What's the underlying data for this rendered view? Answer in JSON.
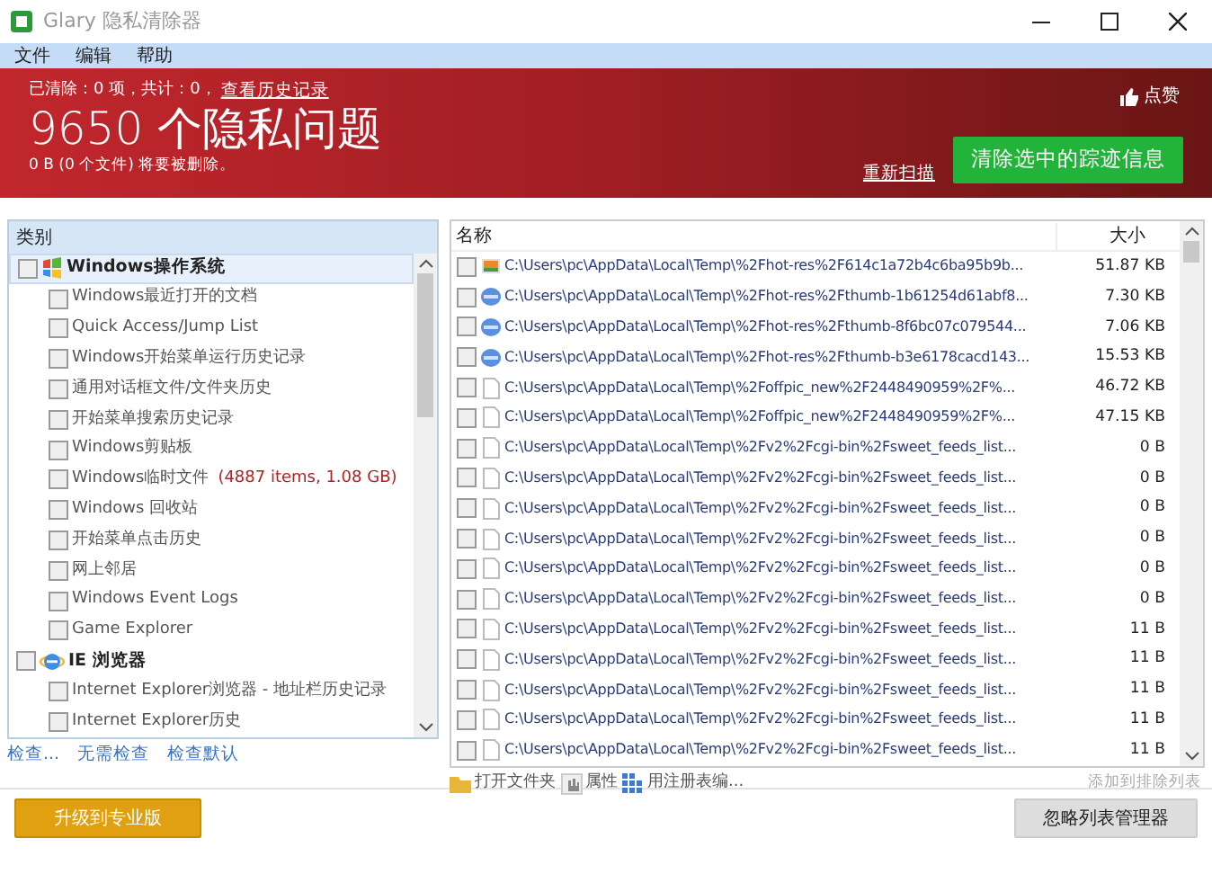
{
  "window": {
    "title": "Glary 隐私清除器"
  },
  "menu": [
    "文件",
    "编辑",
    "帮助"
  ],
  "header": {
    "summary": "已清除：0 项，共计：0，",
    "history_link": "查看历史记录",
    "like": "点赞",
    "headline": "9650 个隐私问题",
    "subline": "0 B (0 个文件) 将要被删除。",
    "rescan_link": "重新扫描",
    "clean_button": "清除选中的踪迹信息"
  },
  "categories": {
    "title": "类别",
    "groups": [
      {
        "label": "Windows操作系统",
        "kind": "windows",
        "checked": false,
        "children": [
          {
            "label": "Windows最近打开的文档",
            "checked": false
          },
          {
            "label": "Quick Access/Jump List",
            "checked": false
          },
          {
            "label": "Windows开始菜单运行历史记录",
            "checked": false
          },
          {
            "label": "通用对话框文件/文件夹历史",
            "checked": false
          },
          {
            "label": "开始菜单搜索历史记录",
            "checked": false
          },
          {
            "label": "Windows剪贴板",
            "checked": false
          },
          {
            "label": "Windows临时文件",
            "detail": "(4887 items, 1.08 GB)",
            "checked": false
          },
          {
            "label": "Windows 回收站",
            "checked": false
          },
          {
            "label": "开始菜单点击历史",
            "checked": false
          },
          {
            "label": "网上邻居",
            "checked": false
          },
          {
            "label": "Windows Event Logs",
            "checked": false
          },
          {
            "label": "Game Explorer",
            "checked": false
          }
        ]
      },
      {
        "label": "IE 浏览器",
        "kind": "ie",
        "checked": false,
        "children": [
          {
            "label": "Internet Explorer浏览器 - 地址栏历史记录",
            "checked": false
          },
          {
            "label": "Internet Explorer历史",
            "checked": false
          }
        ]
      }
    ]
  },
  "check_links": [
    "检查...",
    "无需检查",
    "检查默认"
  ],
  "files": {
    "columns": [
      "名称",
      "大小"
    ],
    "rows": [
      {
        "kind": "image",
        "name": "C:\\Users\\pc\\AppData\\Local\\Temp\\%2Fhot-res%2F614c1a72b4c6ba95b9b...",
        "size": "51.87 KB",
        "checked": false
      },
      {
        "kind": "jpg",
        "name": "C:\\Users\\pc\\AppData\\Local\\Temp\\%2Fhot-res%2Fthumb-1b61254d61abf8...",
        "size": "7.30 KB",
        "checked": false
      },
      {
        "kind": "jpg",
        "name": "C:\\Users\\pc\\AppData\\Local\\Temp\\%2Fhot-res%2Fthumb-8f6bc07c079544...",
        "size": "7.06 KB",
        "checked": false
      },
      {
        "kind": "jpg",
        "name": "C:\\Users\\pc\\AppData\\Local\\Temp\\%2Fhot-res%2Fthumb-b3e6178cacd143...",
        "size": "15.53 KB",
        "checked": false
      },
      {
        "kind": "file",
        "name": "C:\\Users\\pc\\AppData\\Local\\Temp\\%2Foffpic_new%2F2448490959%2F%...",
        "size": "46.72 KB",
        "checked": false
      },
      {
        "kind": "file",
        "name": "C:\\Users\\pc\\AppData\\Local\\Temp\\%2Foffpic_new%2F2448490959%2F%...",
        "size": "47.15 KB",
        "checked": false
      },
      {
        "kind": "file",
        "name": "C:\\Users\\pc\\AppData\\Local\\Temp\\%2Fv2%2Fcgi-bin%2Fsweet_feeds_list...",
        "size": "0 B",
        "checked": false
      },
      {
        "kind": "file",
        "name": "C:\\Users\\pc\\AppData\\Local\\Temp\\%2Fv2%2Fcgi-bin%2Fsweet_feeds_list...",
        "size": "0 B",
        "checked": false
      },
      {
        "kind": "file",
        "name": "C:\\Users\\pc\\AppData\\Local\\Temp\\%2Fv2%2Fcgi-bin%2Fsweet_feeds_list...",
        "size": "0 B",
        "checked": false
      },
      {
        "kind": "file",
        "name": "C:\\Users\\pc\\AppData\\Local\\Temp\\%2Fv2%2Fcgi-bin%2Fsweet_feeds_list...",
        "size": "0 B",
        "checked": false
      },
      {
        "kind": "file",
        "name": "C:\\Users\\pc\\AppData\\Local\\Temp\\%2Fv2%2Fcgi-bin%2Fsweet_feeds_list...",
        "size": "0 B",
        "checked": false
      },
      {
        "kind": "file",
        "name": "C:\\Users\\pc\\AppData\\Local\\Temp\\%2Fv2%2Fcgi-bin%2Fsweet_feeds_list...",
        "size": "0 B",
        "checked": false
      },
      {
        "kind": "file",
        "name": "C:\\Users\\pc\\AppData\\Local\\Temp\\%2Fv2%2Fcgi-bin%2Fsweet_feeds_list...",
        "size": "11 B",
        "checked": false
      },
      {
        "kind": "file",
        "name": "C:\\Users\\pc\\AppData\\Local\\Temp\\%2Fv2%2Fcgi-bin%2Fsweet_feeds_list...",
        "size": "11 B",
        "checked": false
      },
      {
        "kind": "file",
        "name": "C:\\Users\\pc\\AppData\\Local\\Temp\\%2Fv2%2Fcgi-bin%2Fsweet_feeds_list...",
        "size": "11 B",
        "checked": false
      },
      {
        "kind": "file",
        "name": "C:\\Users\\pc\\AppData\\Local\\Temp\\%2Fv2%2Fcgi-bin%2Fsweet_feeds_list...",
        "size": "11 B",
        "checked": false
      },
      {
        "kind": "file",
        "name": "C:\\Users\\pc\\AppData\\Local\\Temp\\%2Fv2%2Fcgi-bin%2Fsweet_feeds_list...",
        "size": "11 B",
        "checked": false
      }
    ]
  },
  "file_actions": [
    {
      "kind": "folder",
      "label": "打开文件夹",
      "disabled": false
    },
    {
      "kind": "properties",
      "label": "属性",
      "disabled": false
    },
    {
      "kind": "registry",
      "label": "用注册表编...",
      "disabled": false
    }
  ],
  "exclude_action": {
    "label": "添加到排除列表",
    "disabled": true
  },
  "upgrade_button": "升级到专业版",
  "ignore_button": "忽略列表管理器"
}
